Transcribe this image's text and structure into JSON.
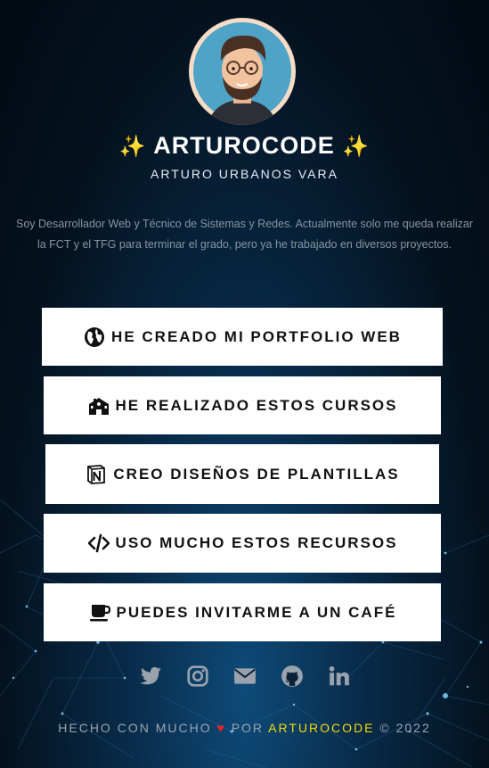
{
  "profile": {
    "avatar": "avatar",
    "name": "ARTUROCODE",
    "sparkle_icon": "✨",
    "fullname": "ARTURO URBANOS VARA",
    "bio": "Soy Desarrollador Web y Técnico de Sistemas y Redes. Actualmente solo me queda realizar la FCT y el TFG para terminar el grado, pero ya he trabajado en diversos proyectos."
  },
  "links": [
    {
      "label": "HE CREADO MI PORTFOLIO WEB",
      "icon": "globe-icon"
    },
    {
      "label": "HE REALIZADO ESTOS CURSOS",
      "icon": "school-icon"
    },
    {
      "label": "CREO DISEÑOS DE PLANTILLAS",
      "icon": "notion-icon"
    },
    {
      "label": "USO MUCHO ESTOS RECURSOS",
      "icon": "code-icon"
    },
    {
      "label": "PUEDES INVITARME A UN CAFÉ",
      "icon": "coffee-icon"
    }
  ],
  "socials": [
    "twitter-icon",
    "instagram-icon",
    "mail-icon",
    "github-icon",
    "linkedin-icon"
  ],
  "footer": {
    "prefix": "HECHO CON MUCHO",
    "heart": "♥",
    "by": "POR",
    "brand": "ARTUROCODE",
    "suffix": "© 2022"
  },
  "colors": {
    "accent": "#f5d90a",
    "heart": "#e8232b",
    "icon": "#9aa3ad"
  }
}
